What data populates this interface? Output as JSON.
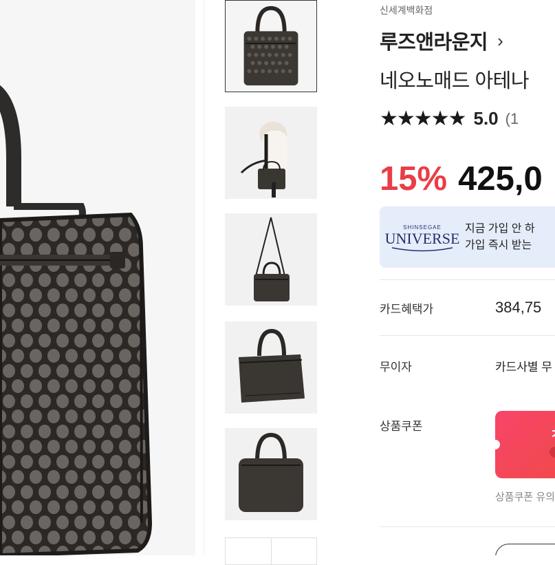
{
  "store": "신세계백화점",
  "brand": {
    "name": "루즈앤라운지",
    "chevron": "›"
  },
  "product": {
    "name": "네오노매드 아테나"
  },
  "rating": {
    "stars": "★★★★★",
    "score": "5.0",
    "count": "(1"
  },
  "price": {
    "discount": "15%",
    "amount": "425,0"
  },
  "banner": {
    "logo_small": "SHINSEGAE",
    "logo_big": "UNIVERSE",
    "line1": "지금 가입 안 하",
    "line2": "가입 즉시 받는"
  },
  "rows": {
    "card_label": "카드혜택가",
    "card_value": "384,75",
    "interest_label": "무이자",
    "interest_value": "카드사별 무",
    "coupon_label": "상품쿠폰",
    "coupon_glyph": "ㅈ",
    "coupon_note": "상품쿠폰 유의"
  },
  "icons": {
    "star": "star-icon",
    "chevron": "chevron-right-icon"
  },
  "colors": {
    "discount": "#ea3d47",
    "banner_bg": "#e5edfb",
    "coupon": "#f2455f"
  }
}
